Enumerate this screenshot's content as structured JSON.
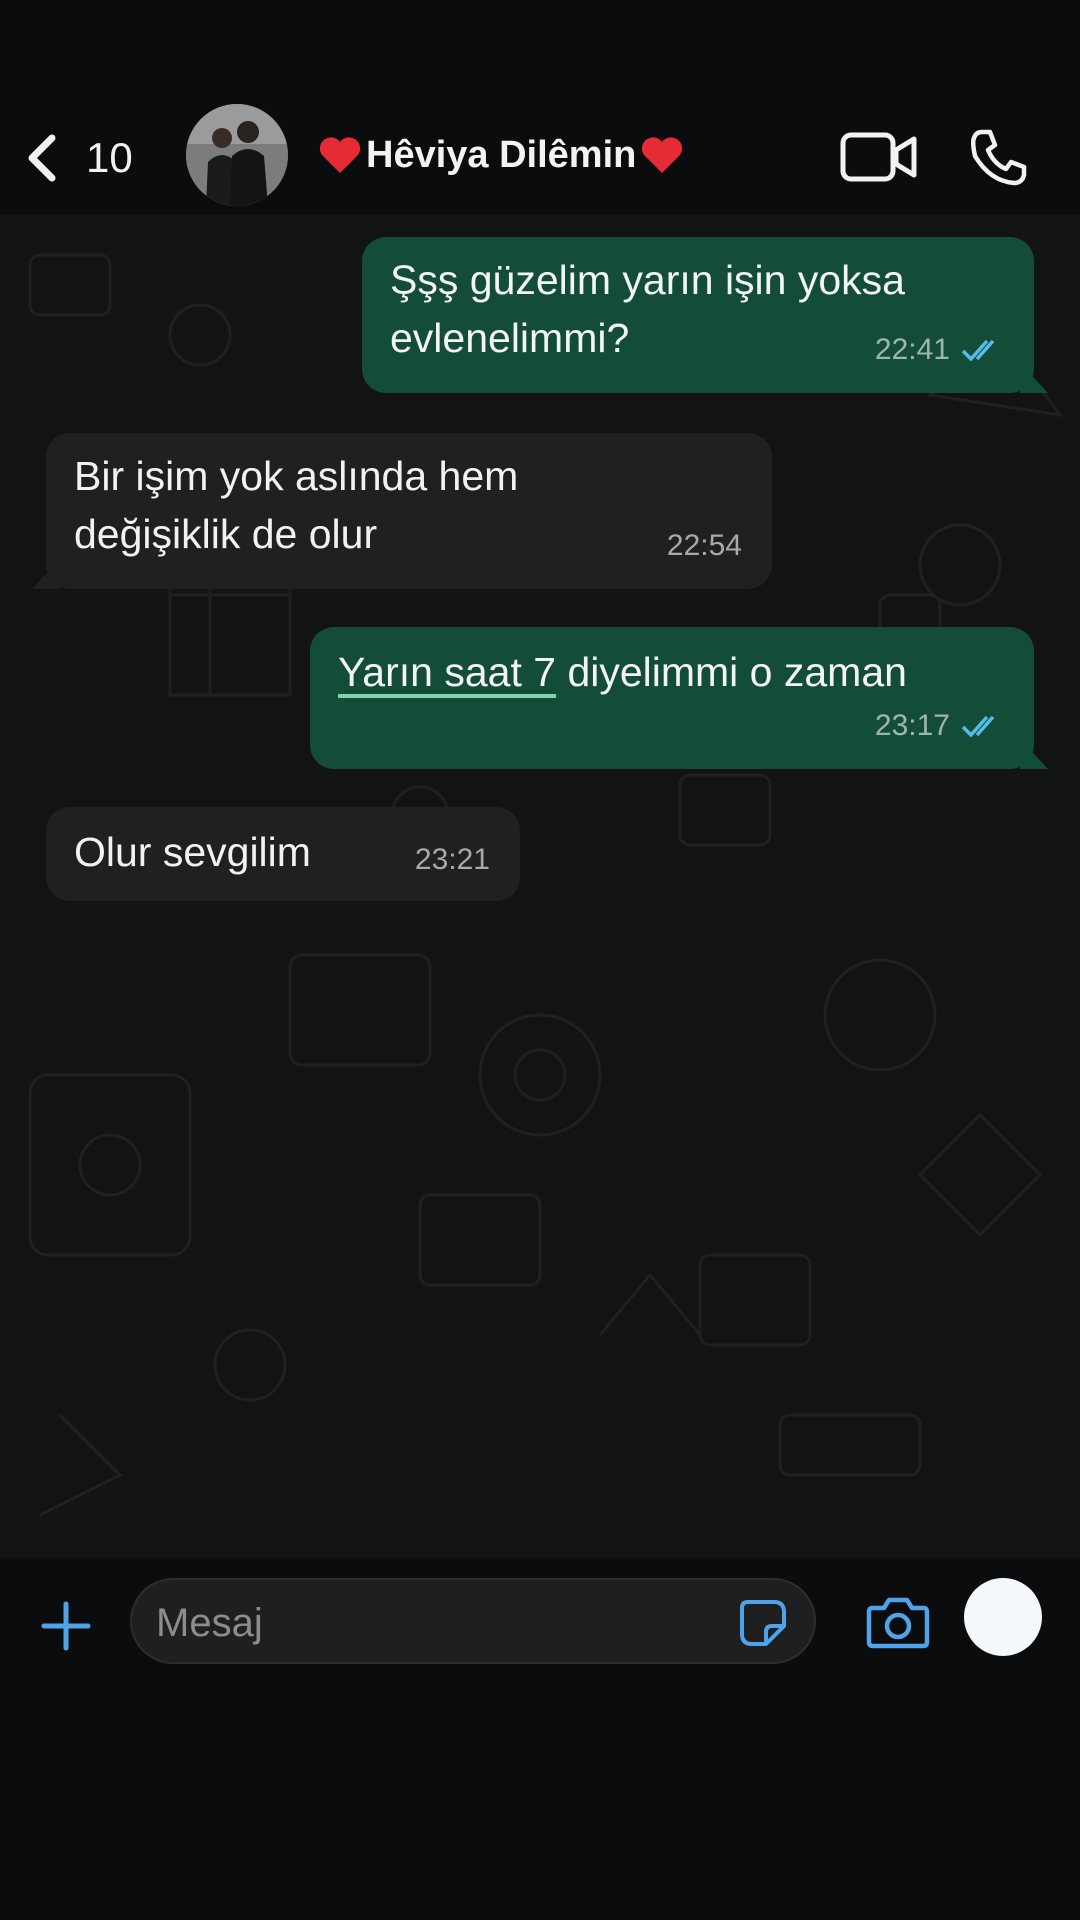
{
  "header": {
    "back_count": "10",
    "contact_name": "Hêviya Dilêmin",
    "heart_emoji": "❤️",
    "icons": [
      "chevron-left-icon",
      "video-call-icon",
      "phone-icon"
    ]
  },
  "messages": [
    {
      "direction": "outgoing",
      "lines": [
        "Şşş güzelim yarın işin yoksa",
        "evlenelimmi?"
      ],
      "time": "22:41",
      "status": "read"
    },
    {
      "direction": "incoming",
      "lines": [
        "Bir işim yok aslında hem",
        "değişiklik de olur"
      ],
      "time": "22:54"
    },
    {
      "direction": "outgoing",
      "link_text": "Yarın saat 7",
      "rest_text": " diyelimmi o zaman",
      "time": "23:17",
      "status": "read"
    },
    {
      "direction": "incoming",
      "lines": [
        "Olur sevgilim"
      ],
      "time": "23:21"
    }
  ],
  "input": {
    "placeholder": "Mesaj"
  },
  "colors": {
    "outgoing_bubble": "#144d37",
    "incoming_bubble": "#1f2022",
    "accent": "#53bdeb",
    "ticks": "#53bdeb"
  }
}
